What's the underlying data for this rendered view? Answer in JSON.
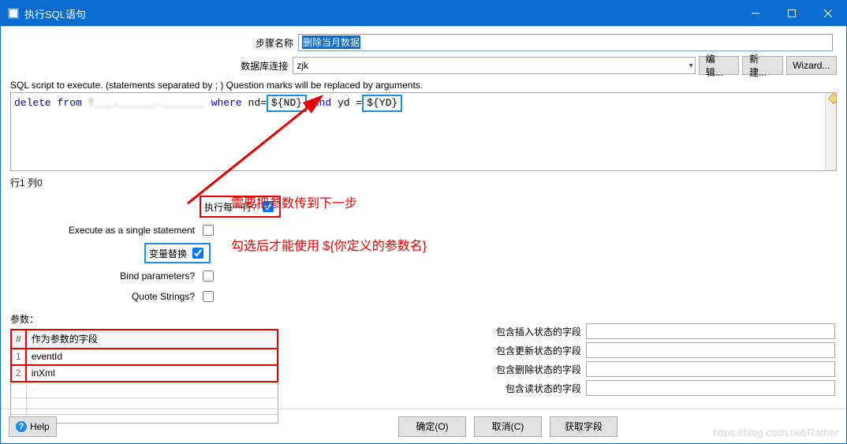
{
  "window": {
    "title": "执行SQL语句"
  },
  "form": {
    "step_label": "步骤名称",
    "step_value": "删除当月数据",
    "conn_label": "数据库连接",
    "conn_value": "zjk",
    "btn_edit": "编辑...",
    "btn_new": "新建...",
    "btn_wizard": "Wizard..."
  },
  "sql": {
    "hint": "SQL script to execute. (statements separated by ; ) Question marks will be replaced by arguments.",
    "kw_delete": "delete from",
    "redacted": "███████████████████",
    "kw_where": "where",
    "nd_eq": "nd=",
    "var_nd": "${ND}",
    "kw_and": "and",
    "yd_eq": "yd =",
    "var_yd": "${YD}",
    "pos": "行1 列0"
  },
  "checks": {
    "c1": "执行每一行?",
    "c2": "Execute as a single statement",
    "c3": "变量替换",
    "c4": "Bind parameters?",
    "c5": "Quote Strings?"
  },
  "anno": {
    "a1": "需要把参数传到下一步",
    "a2": "勾选后才能使用 ${你定义的参数名}"
  },
  "params": {
    "label": "参数：",
    "header_num": "#",
    "header_field": "作为参数的字段",
    "rows": [
      "eventId",
      "inXml"
    ],
    "r1": "1",
    "r2": "2"
  },
  "right": {
    "f1": "包含插入状态的字段",
    "f2": "包含更新状态的字段",
    "f3": "包含删除状态的字段",
    "f4": "包含读状态的字段"
  },
  "footer": {
    "help": "Help",
    "ok": "确定(O)",
    "cancel": "取消(C)",
    "get": "获取字段"
  },
  "watermark": "https://blog.csdn.net/Rather"
}
